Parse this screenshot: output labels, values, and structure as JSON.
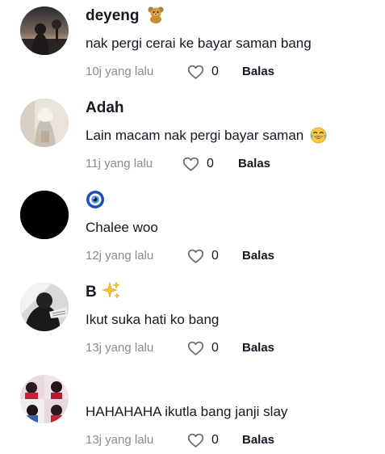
{
  "comments": [
    {
      "username": "deyeng",
      "username_emoji": "teddy-bear",
      "text": "nak pergi cerai ke bayar saman bang",
      "text_emoji": "",
      "timestamp": "10j yang lalu",
      "likes": "0",
      "reply_label": "Balas"
    },
    {
      "username": "Adah",
      "username_emoji": "",
      "text": "Lain macam nak pergi bayar saman",
      "text_emoji": "tears-of-joy",
      "timestamp": "11j yang lalu",
      "likes": "0",
      "reply_label": "Balas"
    },
    {
      "username": "",
      "username_emoji": "nazar-amulet",
      "text": "Chalee woo",
      "text_emoji": "",
      "timestamp": "12j yang lalu",
      "likes": "0",
      "reply_label": "Balas"
    },
    {
      "username": "B",
      "username_emoji": "sparkles",
      "text": "Ikut suka hati ko bang",
      "text_emoji": "",
      "timestamp": "13j yang lalu",
      "likes": "0",
      "reply_label": "Balas"
    },
    {
      "username": "",
      "username_emoji": "",
      "text": "HAHAHAHA ikutla bang janji slay",
      "text_emoji": "",
      "timestamp": "13j yang lalu",
      "likes": "0",
      "reply_label": "Balas"
    }
  ],
  "colors": {
    "text_primary": "#161823",
    "text_secondary": "#8a8b91",
    "background": "#ffffff"
  }
}
